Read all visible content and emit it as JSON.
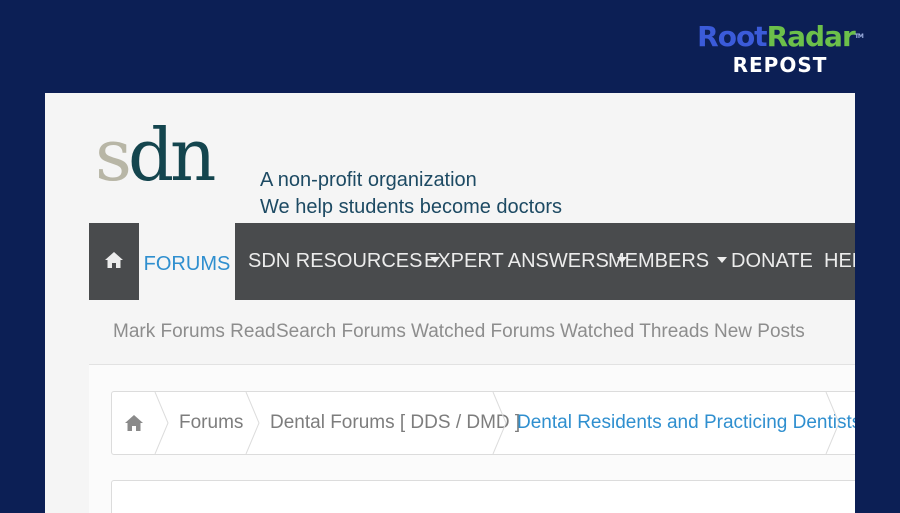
{
  "watermark": {
    "logo_root": "Root",
    "logo_radar": "Radar",
    "logo_tm": "TM",
    "subtitle": "REPOST"
  },
  "header": {
    "logo_s": "s",
    "logo_dn": "dn",
    "tagline_line1": "A non-profit organization",
    "tagline_line2": "We help students become doctors"
  },
  "nav": {
    "home_icon": "home-icon",
    "items": [
      {
        "label": "FORUMS",
        "active": true
      },
      {
        "label": "SDN RESOURCES",
        "dropdown": true
      },
      {
        "label": "EXPERT ANSWERS",
        "dropdown": true
      },
      {
        "label": "MEMBERS",
        "dropdown": true
      },
      {
        "label": "DONATE"
      },
      {
        "label": "HEL"
      }
    ]
  },
  "subnav": {
    "items": [
      "Mark Forums Read",
      "Search Forums",
      "Watched Forums",
      "Watched Threads",
      "New Posts"
    ]
  },
  "breadcrumb": {
    "home_icon": "home-icon",
    "items": [
      "Forums",
      "Dental Forums [ DDS / DMD ]",
      "Dental Residents and Practicing Dentists"
    ]
  },
  "colors": {
    "background": "#0c1f55",
    "nav_bg": "#494b4d",
    "accent": "#2f8fcf",
    "logo_dark": "#14454e",
    "logo_light": "#b8b6a6"
  }
}
